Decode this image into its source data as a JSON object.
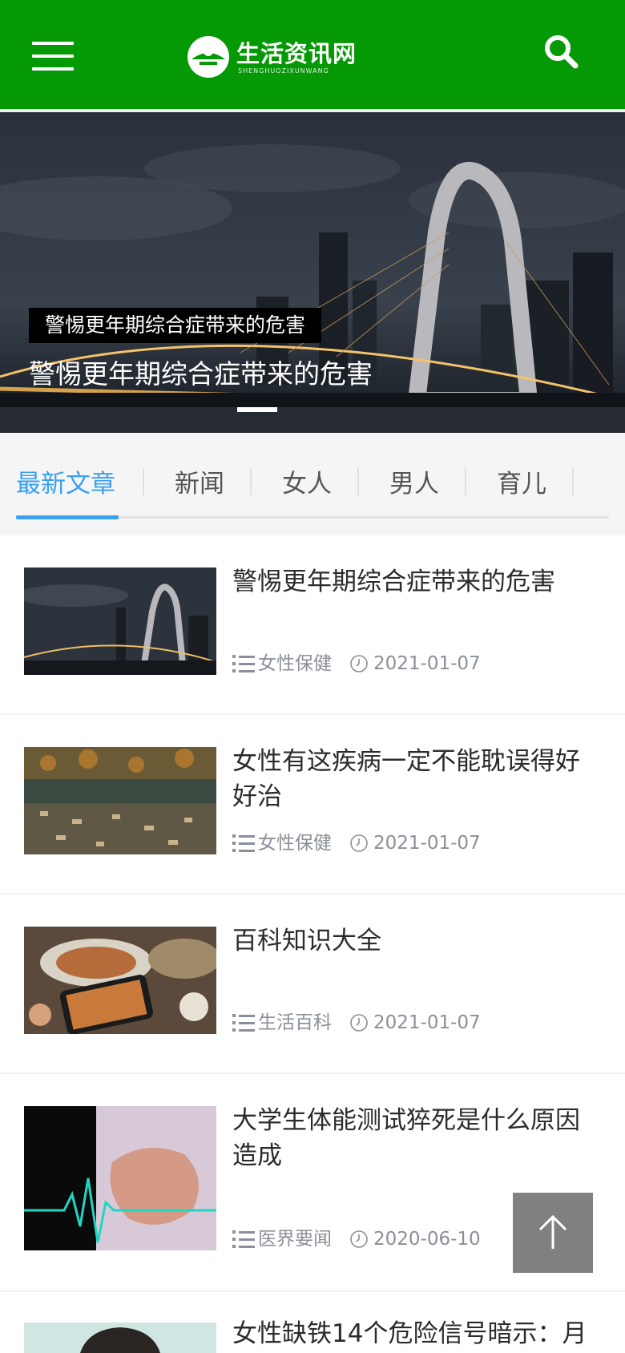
{
  "header": {
    "logo_text": "生活资讯网",
    "logo_sub": "SHENGHUOZIXUNWANG",
    "brand_color": "#059a05",
    "menu_icon": "hamburger-menu-icon",
    "search_icon": "search-icon"
  },
  "banner": {
    "tag": "警惕更年期综合症带来的危害",
    "title": "警惕更年期综合症带来的危害"
  },
  "tabs": [
    {
      "label": "最新文章",
      "active": true
    },
    {
      "label": "新闻",
      "active": false
    },
    {
      "label": "女人",
      "active": false
    },
    {
      "label": "男人",
      "active": false
    },
    {
      "label": "育儿",
      "active": false
    }
  ],
  "accent_color": "#3aa0f0",
  "articles": [
    {
      "title": "警惕更年期综合症带来的危害",
      "category": "女性保健",
      "date": "2021-01-07"
    },
    {
      "title": "女性有这疾病一定不能耽误得好好治",
      "category": "女性保健",
      "date": "2021-01-07"
    },
    {
      "title": "百科知识大全",
      "category": "生活百科",
      "date": "2021-01-07"
    },
    {
      "title": "大学生体能测试猝死是什么原因造成",
      "category": "医界要闻",
      "date": "2020-06-10"
    },
    {
      "title": "女性缺铁14个危险信号暗示：月",
      "category": "",
      "date": ""
    }
  ],
  "back_to_top_icon": "arrow-up-icon"
}
